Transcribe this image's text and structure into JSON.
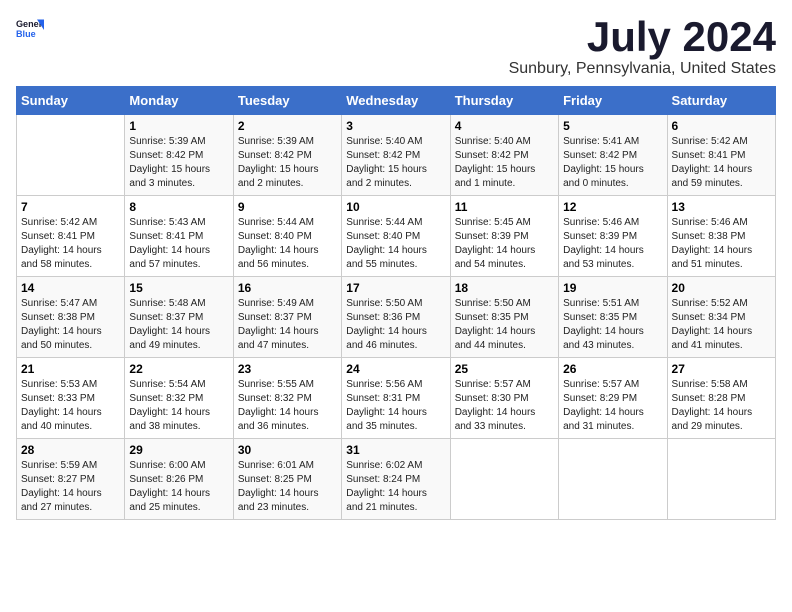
{
  "logo": {
    "general": "General",
    "blue": "Blue"
  },
  "title": {
    "month_year": "July 2024",
    "location": "Sunbury, Pennsylvania, United States"
  },
  "weekdays": [
    "Sunday",
    "Monday",
    "Tuesday",
    "Wednesday",
    "Thursday",
    "Friday",
    "Saturday"
  ],
  "weeks": [
    [
      {
        "day": "",
        "empty": true
      },
      {
        "day": "1",
        "sunrise": "Sunrise: 5:39 AM",
        "sunset": "Sunset: 8:42 PM",
        "daylight": "Daylight: 15 hours and 3 minutes."
      },
      {
        "day": "2",
        "sunrise": "Sunrise: 5:39 AM",
        "sunset": "Sunset: 8:42 PM",
        "daylight": "Daylight: 15 hours and 2 minutes."
      },
      {
        "day": "3",
        "sunrise": "Sunrise: 5:40 AM",
        "sunset": "Sunset: 8:42 PM",
        "daylight": "Daylight: 15 hours and 2 minutes."
      },
      {
        "day": "4",
        "sunrise": "Sunrise: 5:40 AM",
        "sunset": "Sunset: 8:42 PM",
        "daylight": "Daylight: 15 hours and 1 minute."
      },
      {
        "day": "5",
        "sunrise": "Sunrise: 5:41 AM",
        "sunset": "Sunset: 8:42 PM",
        "daylight": "Daylight: 15 hours and 0 minutes."
      },
      {
        "day": "6",
        "sunrise": "Sunrise: 5:42 AM",
        "sunset": "Sunset: 8:41 PM",
        "daylight": "Daylight: 14 hours and 59 minutes."
      }
    ],
    [
      {
        "day": "7",
        "sunrise": "Sunrise: 5:42 AM",
        "sunset": "Sunset: 8:41 PM",
        "daylight": "Daylight: 14 hours and 58 minutes."
      },
      {
        "day": "8",
        "sunrise": "Sunrise: 5:43 AM",
        "sunset": "Sunset: 8:41 PM",
        "daylight": "Daylight: 14 hours and 57 minutes."
      },
      {
        "day": "9",
        "sunrise": "Sunrise: 5:44 AM",
        "sunset": "Sunset: 8:40 PM",
        "daylight": "Daylight: 14 hours and 56 minutes."
      },
      {
        "day": "10",
        "sunrise": "Sunrise: 5:44 AM",
        "sunset": "Sunset: 8:40 PM",
        "daylight": "Daylight: 14 hours and 55 minutes."
      },
      {
        "day": "11",
        "sunrise": "Sunrise: 5:45 AM",
        "sunset": "Sunset: 8:39 PM",
        "daylight": "Daylight: 14 hours and 54 minutes."
      },
      {
        "day": "12",
        "sunrise": "Sunrise: 5:46 AM",
        "sunset": "Sunset: 8:39 PM",
        "daylight": "Daylight: 14 hours and 53 minutes."
      },
      {
        "day": "13",
        "sunrise": "Sunrise: 5:46 AM",
        "sunset": "Sunset: 8:38 PM",
        "daylight": "Daylight: 14 hours and 51 minutes."
      }
    ],
    [
      {
        "day": "14",
        "sunrise": "Sunrise: 5:47 AM",
        "sunset": "Sunset: 8:38 PM",
        "daylight": "Daylight: 14 hours and 50 minutes."
      },
      {
        "day": "15",
        "sunrise": "Sunrise: 5:48 AM",
        "sunset": "Sunset: 8:37 PM",
        "daylight": "Daylight: 14 hours and 49 minutes."
      },
      {
        "day": "16",
        "sunrise": "Sunrise: 5:49 AM",
        "sunset": "Sunset: 8:37 PM",
        "daylight": "Daylight: 14 hours and 47 minutes."
      },
      {
        "day": "17",
        "sunrise": "Sunrise: 5:50 AM",
        "sunset": "Sunset: 8:36 PM",
        "daylight": "Daylight: 14 hours and 46 minutes."
      },
      {
        "day": "18",
        "sunrise": "Sunrise: 5:50 AM",
        "sunset": "Sunset: 8:35 PM",
        "daylight": "Daylight: 14 hours and 44 minutes."
      },
      {
        "day": "19",
        "sunrise": "Sunrise: 5:51 AM",
        "sunset": "Sunset: 8:35 PM",
        "daylight": "Daylight: 14 hours and 43 minutes."
      },
      {
        "day": "20",
        "sunrise": "Sunrise: 5:52 AM",
        "sunset": "Sunset: 8:34 PM",
        "daylight": "Daylight: 14 hours and 41 minutes."
      }
    ],
    [
      {
        "day": "21",
        "sunrise": "Sunrise: 5:53 AM",
        "sunset": "Sunset: 8:33 PM",
        "daylight": "Daylight: 14 hours and 40 minutes."
      },
      {
        "day": "22",
        "sunrise": "Sunrise: 5:54 AM",
        "sunset": "Sunset: 8:32 PM",
        "daylight": "Daylight: 14 hours and 38 minutes."
      },
      {
        "day": "23",
        "sunrise": "Sunrise: 5:55 AM",
        "sunset": "Sunset: 8:32 PM",
        "daylight": "Daylight: 14 hours and 36 minutes."
      },
      {
        "day": "24",
        "sunrise": "Sunrise: 5:56 AM",
        "sunset": "Sunset: 8:31 PM",
        "daylight": "Daylight: 14 hours and 35 minutes."
      },
      {
        "day": "25",
        "sunrise": "Sunrise: 5:57 AM",
        "sunset": "Sunset: 8:30 PM",
        "daylight": "Daylight: 14 hours and 33 minutes."
      },
      {
        "day": "26",
        "sunrise": "Sunrise: 5:57 AM",
        "sunset": "Sunset: 8:29 PM",
        "daylight": "Daylight: 14 hours and 31 minutes."
      },
      {
        "day": "27",
        "sunrise": "Sunrise: 5:58 AM",
        "sunset": "Sunset: 8:28 PM",
        "daylight": "Daylight: 14 hours and 29 minutes."
      }
    ],
    [
      {
        "day": "28",
        "sunrise": "Sunrise: 5:59 AM",
        "sunset": "Sunset: 8:27 PM",
        "daylight": "Daylight: 14 hours and 27 minutes."
      },
      {
        "day": "29",
        "sunrise": "Sunrise: 6:00 AM",
        "sunset": "Sunset: 8:26 PM",
        "daylight": "Daylight: 14 hours and 25 minutes."
      },
      {
        "day": "30",
        "sunrise": "Sunrise: 6:01 AM",
        "sunset": "Sunset: 8:25 PM",
        "daylight": "Daylight: 14 hours and 23 minutes."
      },
      {
        "day": "31",
        "sunrise": "Sunrise: 6:02 AM",
        "sunset": "Sunset: 8:24 PM",
        "daylight": "Daylight: 14 hours and 21 minutes."
      },
      {
        "day": "",
        "empty": true
      },
      {
        "day": "",
        "empty": true
      },
      {
        "day": "",
        "empty": true
      }
    ]
  ]
}
